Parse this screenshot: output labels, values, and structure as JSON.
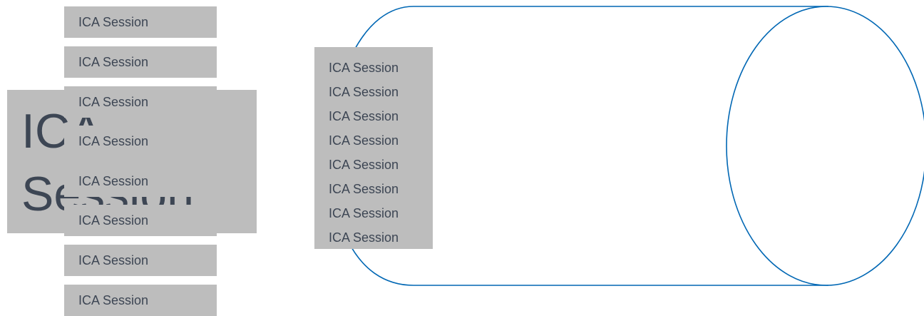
{
  "colors": {
    "tile_fill": "#bdbdbd",
    "text": "#3d4654",
    "cylinder_stroke": "#0067b4",
    "background": "#ffffff"
  },
  "big_label": "ICA Session",
  "stack_tiles": [
    {
      "label": "ICA Session"
    },
    {
      "label": "ICA Session"
    },
    {
      "label": "ICA Session"
    },
    {
      "label": "ICA Session"
    },
    {
      "label": "ICA Session"
    },
    {
      "label": "ICA Session"
    },
    {
      "label": "ICA Session"
    },
    {
      "label": "ICA Session"
    }
  ],
  "cylinder_list": [
    "ICA Session",
    "ICA Session",
    "ICA Session",
    "ICA Session",
    "ICA Session",
    "ICA Session",
    "ICA Session",
    "ICA Session"
  ]
}
